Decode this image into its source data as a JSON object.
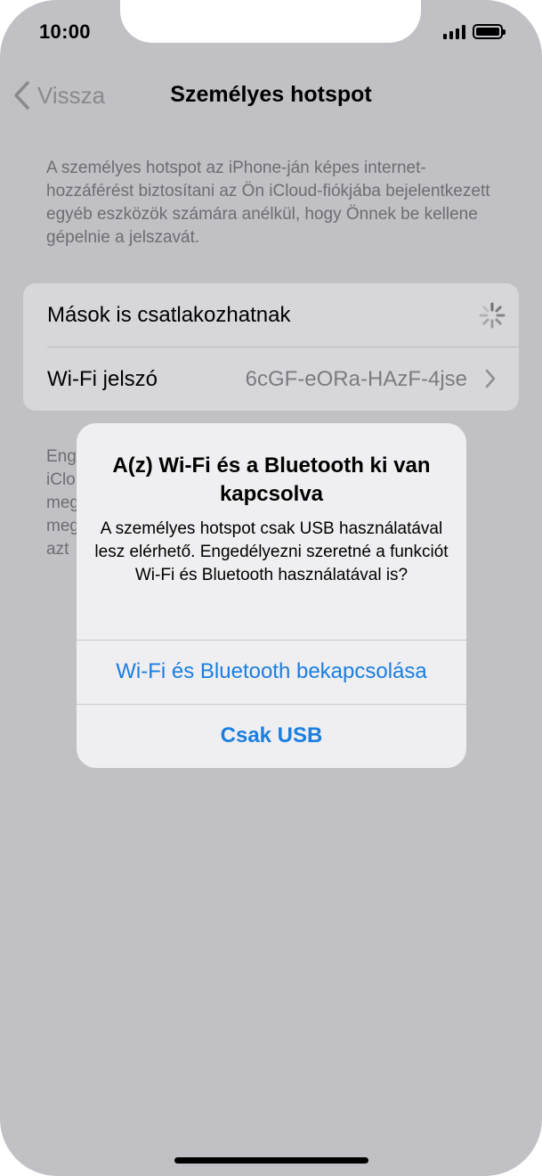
{
  "status_bar": {
    "time": "10:00"
  },
  "nav": {
    "back_label": "Vissza",
    "title": "Személyes hotspot"
  },
  "description": "A személyes hotspot az iPhone-ján képes internet-hozzáférést biztosítani az Ön iCloud-fiókjába bejelentkezett egyéb eszközök számára anélkül, hogy Önnek be kellene gépelnie a jelszavát.",
  "settings": {
    "allow_others_label": "Mások is csatlakozhatnak",
    "wifi_password_label": "Wi-Fi jelszó",
    "wifi_password_value": "6cGF-eORa-HAzF-4jse"
  },
  "footer_lines": [
    "Eng",
    "iClo",
    "meg",
    "meg",
    "azt"
  ],
  "alert": {
    "title": "A(z) Wi-Fi és a Bluetooth ki van kapcsolva",
    "message": "A személyes hotspot csak USB használatával lesz elérhető. Engedélyezni szeretné a funkciót Wi-Fi és Bluetooth használatával is?",
    "primary_button": "Wi-Fi és Bluetooth bekapcsolása",
    "secondary_button": "Csak USB"
  },
  "colors": {
    "background": "#c1c0c5",
    "alert_accent": "#1b7ee0"
  }
}
